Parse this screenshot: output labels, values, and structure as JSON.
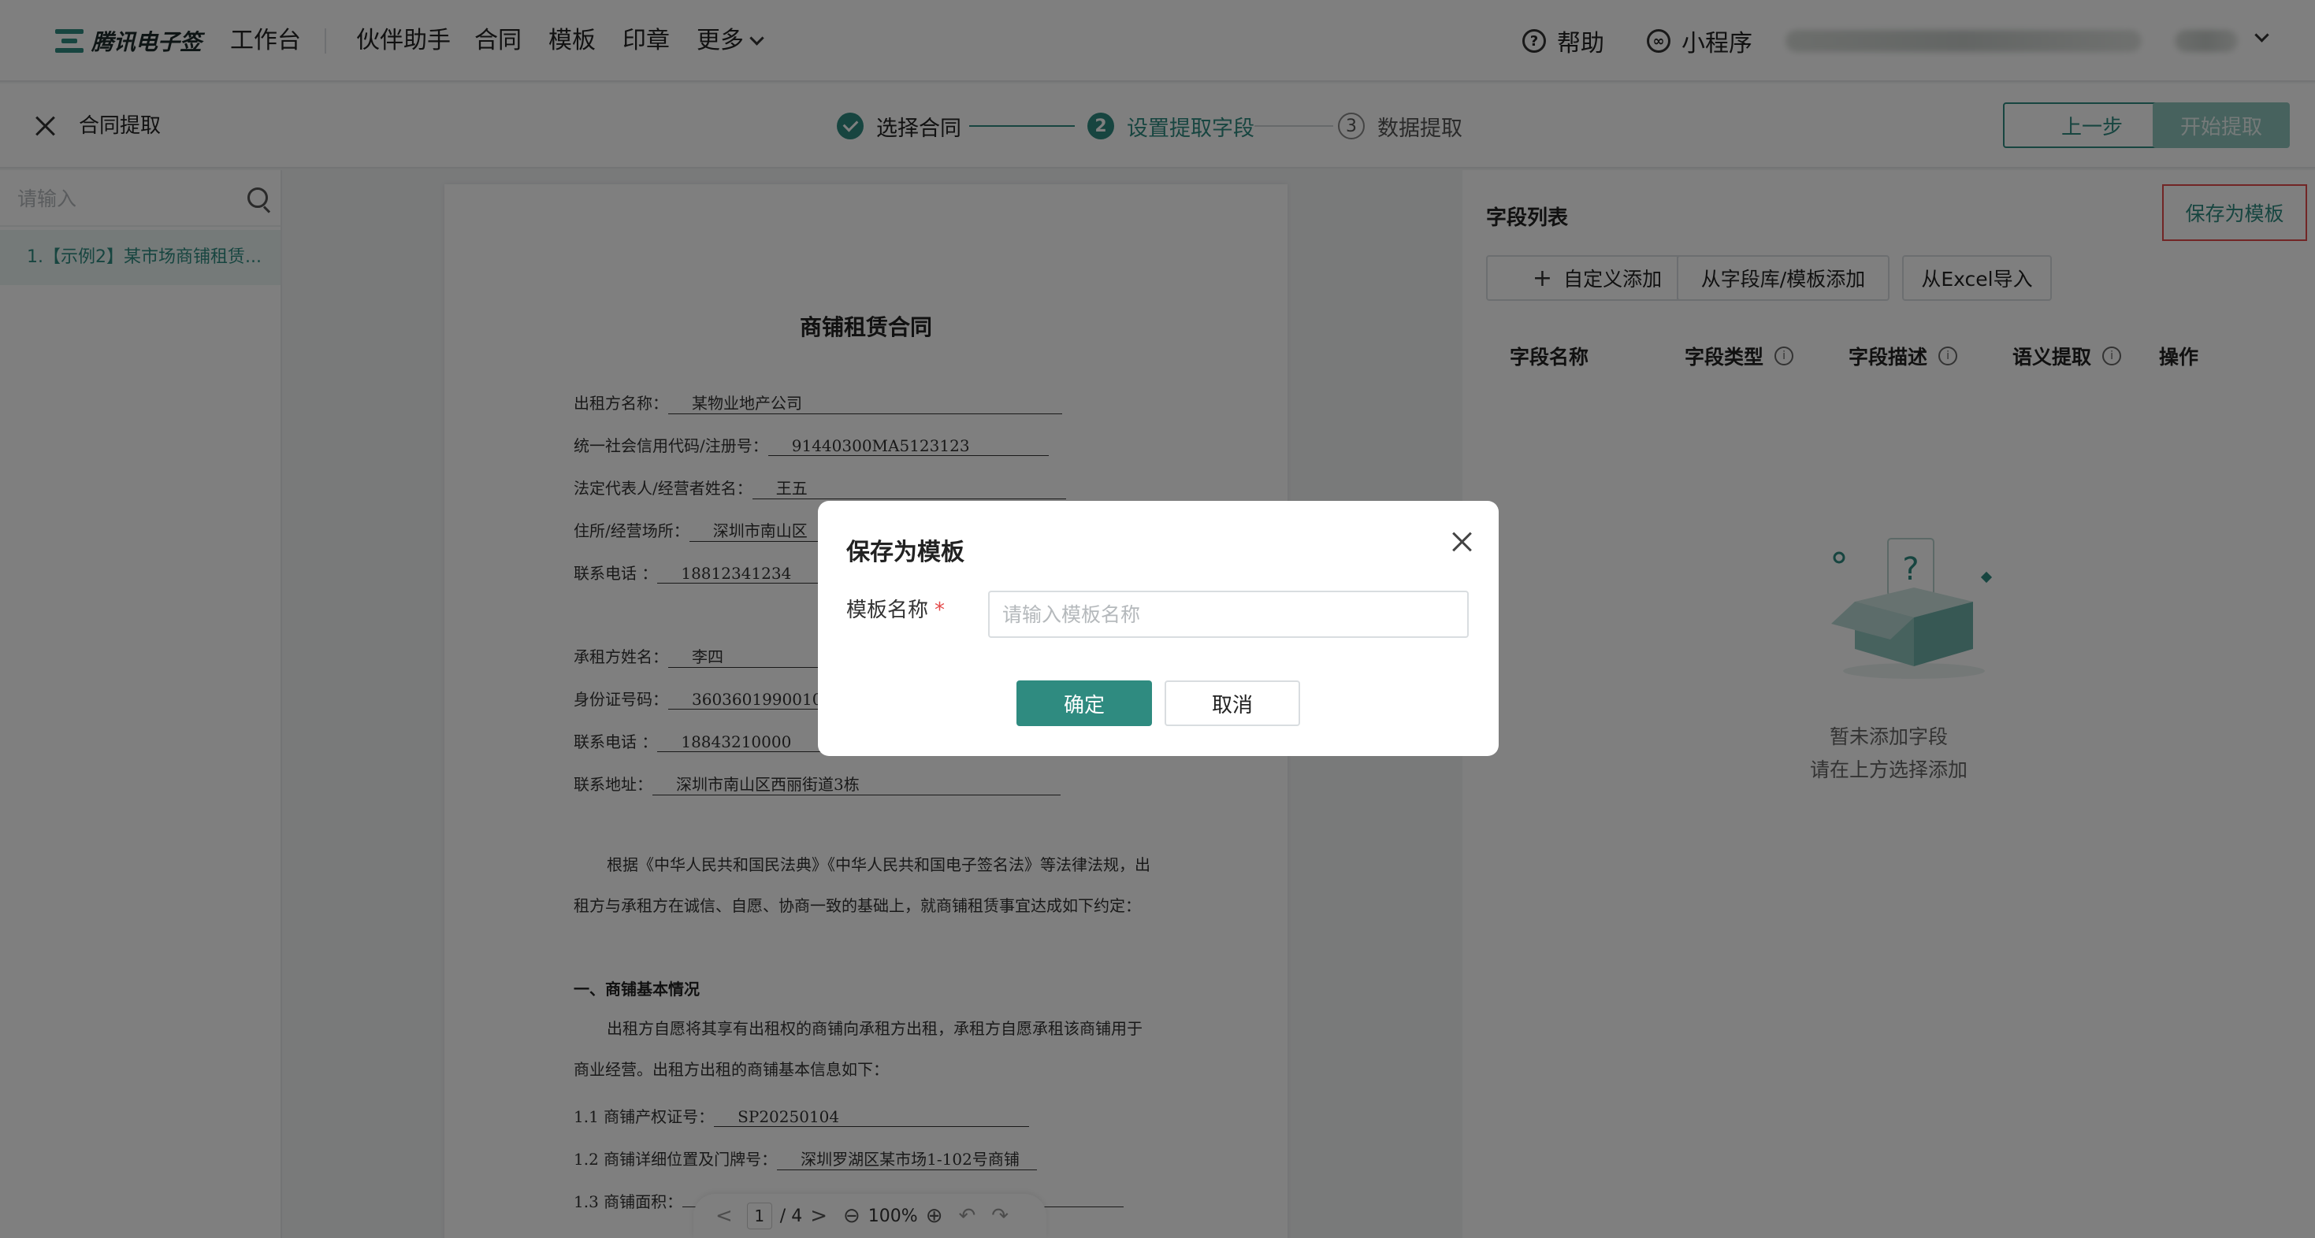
{
  "topnav": {
    "logo_text": "腾讯电子签",
    "items": [
      "工作台",
      "伙伴助手",
      "合同",
      "模板",
      "印章",
      "更多"
    ],
    "help": "帮助",
    "help_icon": "?",
    "miniapp": "小程序",
    "miniapp_icon": "∞"
  },
  "subbar": {
    "title": "合同提取",
    "steps": [
      {
        "num": "",
        "label": "选择合同",
        "state": "done"
      },
      {
        "num": "2",
        "label": "设置提取字段",
        "state": "active"
      },
      {
        "num": "3",
        "label": "数据提取",
        "state": "todo"
      }
    ],
    "prev_label": "上一步",
    "start_label": "开始提取"
  },
  "sidebar": {
    "search_placeholder": "请输入",
    "items": [
      "1.【示例2】某市场商铺租赁..."
    ]
  },
  "document": {
    "title": "商铺租赁合同",
    "lines": [
      {
        "label": "出租方名称：",
        "value": "某物业地产公司"
      },
      {
        "label": "统一社会信用代码/注册号：",
        "value": "91440300MA5123123"
      },
      {
        "label": "法定代表人/经营者姓名：",
        "value": "王五"
      },
      {
        "label": "住所/经营场所：",
        "value": "深圳市南山区"
      },
      {
        "label": "联系电话 ：",
        "value": "18812341234"
      },
      {
        "label": "承租方姓名：",
        "value": "李四"
      },
      {
        "label": "身份证号码：",
        "value": "36036019900101"
      },
      {
        "label": "联系电话 ：",
        "value": "18843210000"
      },
      {
        "label": "联系地址：",
        "value": "深圳市南山区西丽街道3栋"
      }
    ],
    "para1": "根据《中华人民共和国民法典》《中华人民共和国电子签名法》等法律法规，出租方与承租方在诚信、自愿、协商一致的基础上，就商铺租赁事宜达成如下约定：",
    "section1": "一、商铺基本情况",
    "para2": "出租方自愿将其享有出租权的商铺向承租方出租，承租方自愿承租该商铺用于商业经营。出租方出租的商铺基本信息如下：",
    "item1_label": "1.1 商铺产权证号：",
    "item1_value": "SP20250104",
    "item2_label": "1.2 商铺详细位置及门牌号：",
    "item2_value": "深圳罗湖区某市场1-102号商铺",
    "item3_label": "1.3 商铺面积："
  },
  "pager": {
    "prev": "<",
    "current": "1",
    "total": "/ 4",
    "next": ">",
    "zoom_out": "⊖",
    "zoom": "100%",
    "zoom_in": "⊕",
    "undo": "↶",
    "redo": "↷"
  },
  "fields": {
    "title": "字段列表",
    "save_template": "保存为模板",
    "add_custom": "自定义添加",
    "add_from_library": "从字段库/模板添加",
    "import_excel": "从Excel导入",
    "columns": [
      "字段名称",
      "字段类型",
      "字段描述",
      "语义提取",
      "操作"
    ],
    "empty_line1": "暂未添加字段",
    "empty_line2": "请在上方选择添加"
  },
  "modal": {
    "title": "保存为模板",
    "field_label": "模板名称",
    "required_mark": "*",
    "placeholder": "请输入模板名称",
    "ok": "确定",
    "cancel": "取消"
  },
  "colors": {
    "brand": "#2f8b80",
    "highlight_border": "#e44a4a"
  }
}
